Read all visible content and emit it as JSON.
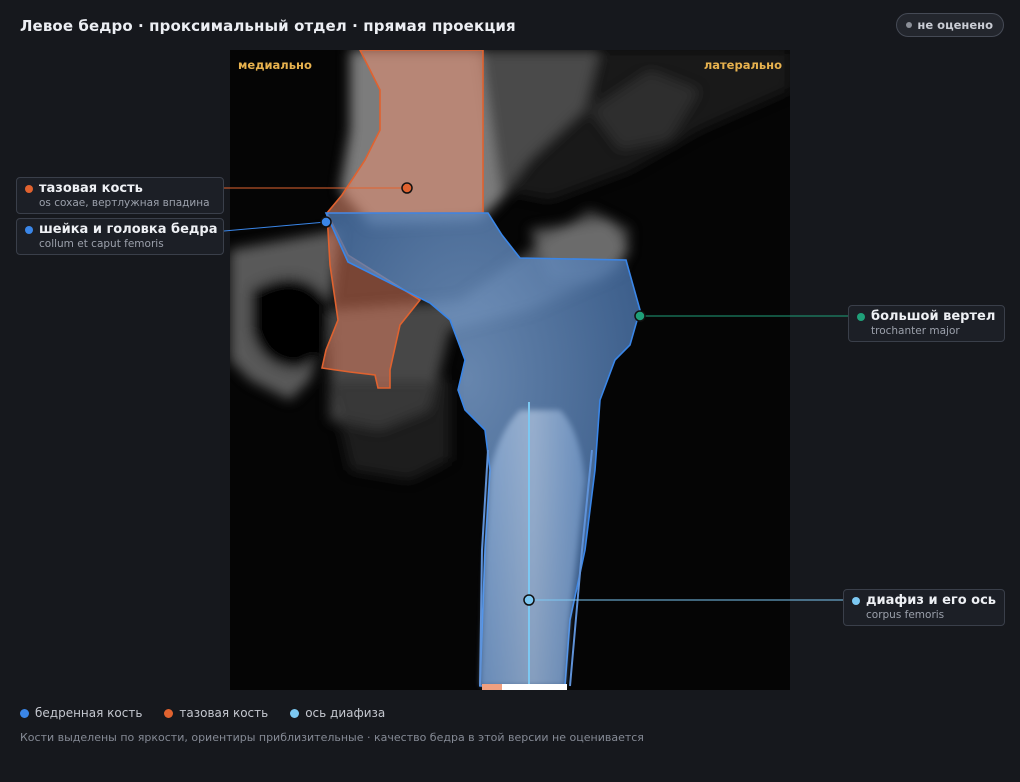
{
  "header": {
    "title": "Левое бедро · проксимальный отдел · прямая проекция",
    "status_badge": "не оценено"
  },
  "image": {
    "orientation_medial": "медиально",
    "orientation_lateral": "латерально"
  },
  "labels": [
    {
      "name": "тазовая кость",
      "latin": "os coxae, вертлужная впадина",
      "color": "#e0622f"
    },
    {
      "name": "шейка и головка бедра",
      "latin": "collum et caput femoris",
      "color": "#3a86e8"
    },
    {
      "name": "большой вертел",
      "latin": "trochanter major",
      "color": "#1fa079"
    },
    {
      "name": "диафиз и его ось",
      "latin": "corpus femoris",
      "color": "#7cc8f2"
    }
  ],
  "legend": [
    {
      "label": "бедренная кость",
      "color": "#3a86e8"
    },
    {
      "label": "тазовая кость",
      "color": "#e0622f"
    },
    {
      "label": "ось диафиза",
      "color": "#7cc8f2"
    }
  ],
  "footnote": "Кости выделены по яркости, ориентиры приблизительные · качество бедра в этой версии не оценивается"
}
